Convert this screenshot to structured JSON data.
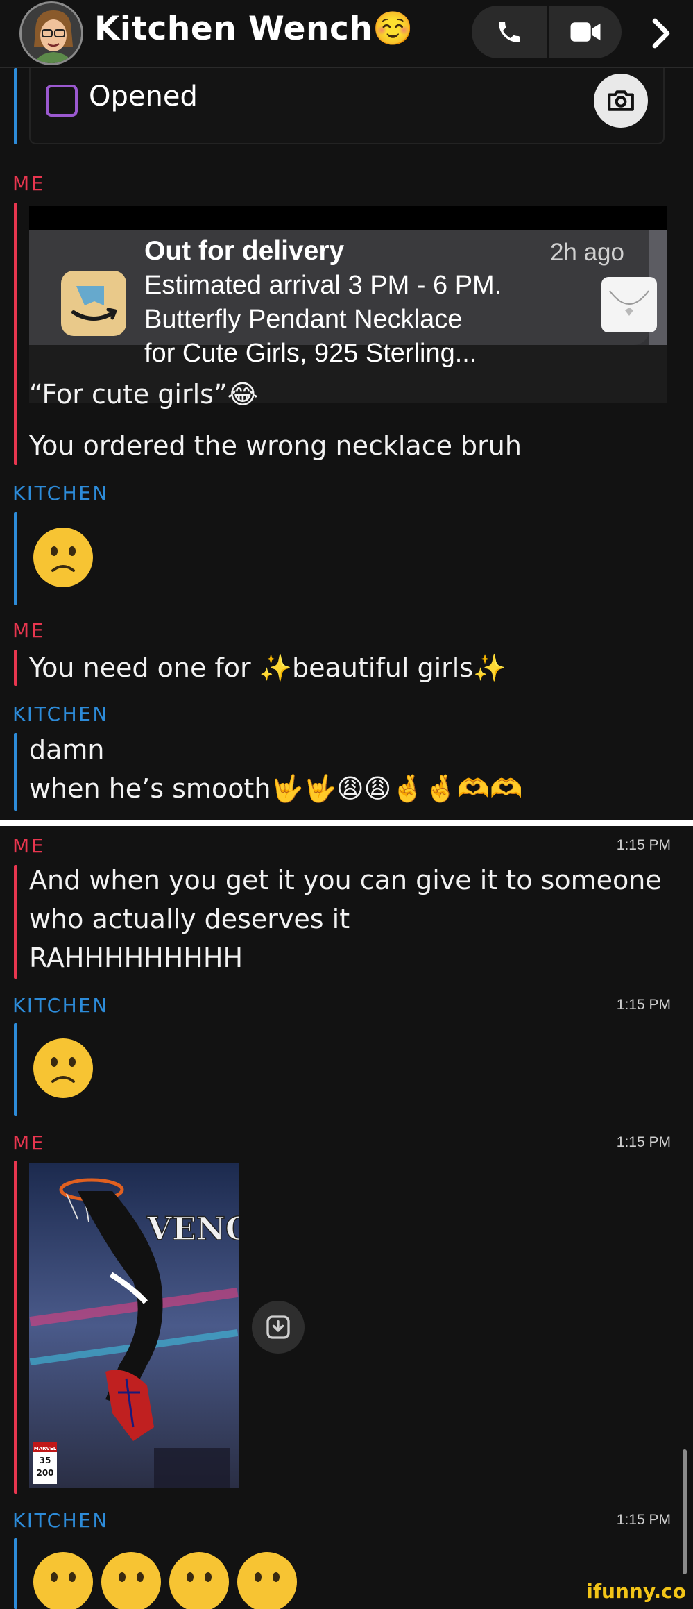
{
  "header": {
    "title": "Kitchen Wench",
    "title_emoji": "☺️",
    "call_icon": "phone-icon",
    "video_icon": "video-icon",
    "chevron_icon": "chevron-right-icon"
  },
  "status": {
    "label": "Opened"
  },
  "senders": {
    "me": "ME",
    "kitchen": "KITCHEN"
  },
  "colors": {
    "me": "#e8364f",
    "kitchen": "#2d8bd8",
    "opened_checkbox": "#9b59d0",
    "watermark": "#f2c418"
  },
  "notification": {
    "title": "Out for delivery",
    "time_ago": "2h ago",
    "line1": "Estimated arrival 3 PM - 6 PM.",
    "line2": "Butterfly Pendant Necklace",
    "line3": "for Cute Girls, 925 Sterling..."
  },
  "messages_top": {
    "m1": "“For cute girls”😂",
    "m2": "You ordered the wrong necklace bruh",
    "m3": "You need one for ✨beautiful girls✨",
    "m4": "damn",
    "m5": "when he’s smooth🤟🤟😩😩🤞🤞🫶🫶"
  },
  "messages_bottom": {
    "time": "1:15 PM",
    "m6_line1": "And when you get it you can give it to someone",
    "m6_line2": "who actually deserves it",
    "m6_line3": "RAHHHHHHHHH"
  },
  "image": {
    "title_text": "VENOM",
    "badge_top": "MARVEL",
    "badge_num": "35",
    "badge_num2": "200"
  },
  "watermark": "ifunny.co"
}
